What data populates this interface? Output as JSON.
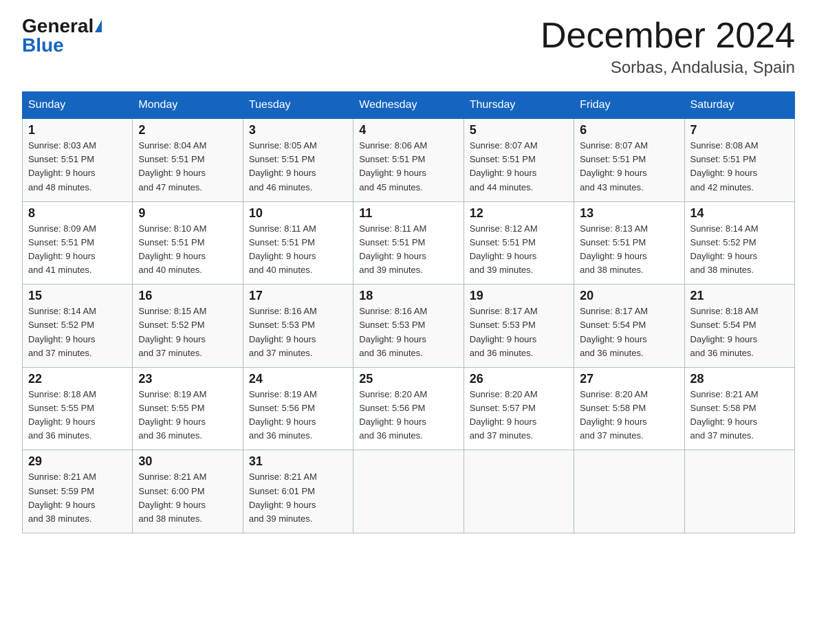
{
  "header": {
    "logo_general": "General",
    "logo_blue": "Blue",
    "month_title": "December 2024",
    "location": "Sorbas, Andalusia, Spain"
  },
  "days_of_week": [
    "Sunday",
    "Monday",
    "Tuesday",
    "Wednesday",
    "Thursday",
    "Friday",
    "Saturday"
  ],
  "weeks": [
    [
      {
        "day": "1",
        "sunrise": "8:03 AM",
        "sunset": "5:51 PM",
        "daylight": "9 hours and 48 minutes."
      },
      {
        "day": "2",
        "sunrise": "8:04 AM",
        "sunset": "5:51 PM",
        "daylight": "9 hours and 47 minutes."
      },
      {
        "day": "3",
        "sunrise": "8:05 AM",
        "sunset": "5:51 PM",
        "daylight": "9 hours and 46 minutes."
      },
      {
        "day": "4",
        "sunrise": "8:06 AM",
        "sunset": "5:51 PM",
        "daylight": "9 hours and 45 minutes."
      },
      {
        "day": "5",
        "sunrise": "8:07 AM",
        "sunset": "5:51 PM",
        "daylight": "9 hours and 44 minutes."
      },
      {
        "day": "6",
        "sunrise": "8:07 AM",
        "sunset": "5:51 PM",
        "daylight": "9 hours and 43 minutes."
      },
      {
        "day": "7",
        "sunrise": "8:08 AM",
        "sunset": "5:51 PM",
        "daylight": "9 hours and 42 minutes."
      }
    ],
    [
      {
        "day": "8",
        "sunrise": "8:09 AM",
        "sunset": "5:51 PM",
        "daylight": "9 hours and 41 minutes."
      },
      {
        "day": "9",
        "sunrise": "8:10 AM",
        "sunset": "5:51 PM",
        "daylight": "9 hours and 40 minutes."
      },
      {
        "day": "10",
        "sunrise": "8:11 AM",
        "sunset": "5:51 PM",
        "daylight": "9 hours and 40 minutes."
      },
      {
        "day": "11",
        "sunrise": "8:11 AM",
        "sunset": "5:51 PM",
        "daylight": "9 hours and 39 minutes."
      },
      {
        "day": "12",
        "sunrise": "8:12 AM",
        "sunset": "5:51 PM",
        "daylight": "9 hours and 39 minutes."
      },
      {
        "day": "13",
        "sunrise": "8:13 AM",
        "sunset": "5:51 PM",
        "daylight": "9 hours and 38 minutes."
      },
      {
        "day": "14",
        "sunrise": "8:14 AM",
        "sunset": "5:52 PM",
        "daylight": "9 hours and 38 minutes."
      }
    ],
    [
      {
        "day": "15",
        "sunrise": "8:14 AM",
        "sunset": "5:52 PM",
        "daylight": "9 hours and 37 minutes."
      },
      {
        "day": "16",
        "sunrise": "8:15 AM",
        "sunset": "5:52 PM",
        "daylight": "9 hours and 37 minutes."
      },
      {
        "day": "17",
        "sunrise": "8:16 AM",
        "sunset": "5:53 PM",
        "daylight": "9 hours and 37 minutes."
      },
      {
        "day": "18",
        "sunrise": "8:16 AM",
        "sunset": "5:53 PM",
        "daylight": "9 hours and 36 minutes."
      },
      {
        "day": "19",
        "sunrise": "8:17 AM",
        "sunset": "5:53 PM",
        "daylight": "9 hours and 36 minutes."
      },
      {
        "day": "20",
        "sunrise": "8:17 AM",
        "sunset": "5:54 PM",
        "daylight": "9 hours and 36 minutes."
      },
      {
        "day": "21",
        "sunrise": "8:18 AM",
        "sunset": "5:54 PM",
        "daylight": "9 hours and 36 minutes."
      }
    ],
    [
      {
        "day": "22",
        "sunrise": "8:18 AM",
        "sunset": "5:55 PM",
        "daylight": "9 hours and 36 minutes."
      },
      {
        "day": "23",
        "sunrise": "8:19 AM",
        "sunset": "5:55 PM",
        "daylight": "9 hours and 36 minutes."
      },
      {
        "day": "24",
        "sunrise": "8:19 AM",
        "sunset": "5:56 PM",
        "daylight": "9 hours and 36 minutes."
      },
      {
        "day": "25",
        "sunrise": "8:20 AM",
        "sunset": "5:56 PM",
        "daylight": "9 hours and 36 minutes."
      },
      {
        "day": "26",
        "sunrise": "8:20 AM",
        "sunset": "5:57 PM",
        "daylight": "9 hours and 37 minutes."
      },
      {
        "day": "27",
        "sunrise": "8:20 AM",
        "sunset": "5:58 PM",
        "daylight": "9 hours and 37 minutes."
      },
      {
        "day": "28",
        "sunrise": "8:21 AM",
        "sunset": "5:58 PM",
        "daylight": "9 hours and 37 minutes."
      }
    ],
    [
      {
        "day": "29",
        "sunrise": "8:21 AM",
        "sunset": "5:59 PM",
        "daylight": "9 hours and 38 minutes."
      },
      {
        "day": "30",
        "sunrise": "8:21 AM",
        "sunset": "6:00 PM",
        "daylight": "9 hours and 38 minutes."
      },
      {
        "day": "31",
        "sunrise": "8:21 AM",
        "sunset": "6:01 PM",
        "daylight": "9 hours and 39 minutes."
      },
      null,
      null,
      null,
      null
    ]
  ],
  "labels": {
    "sunrise": "Sunrise:",
    "sunset": "Sunset:",
    "daylight": "Daylight:"
  }
}
